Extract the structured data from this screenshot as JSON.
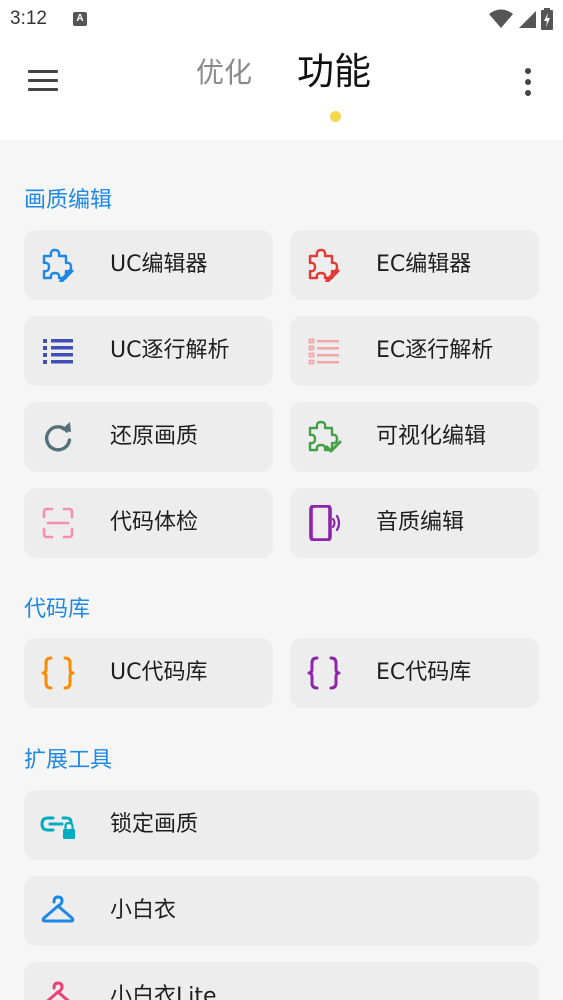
{
  "status_bar": {
    "time": "3:12",
    "notification": "A"
  },
  "header": {
    "tab_optimize": "优化",
    "tab_functions": "功能"
  },
  "sections": {
    "editing": {
      "title": "画质编辑",
      "items": [
        "UC编辑器",
        "EC编辑器",
        "UC逐行解析",
        "EC逐行解析",
        "还原画质",
        "可视化编辑",
        "代码体检",
        "音质编辑"
      ]
    },
    "library": {
      "title": "代码库",
      "items": [
        "UC代码库",
        "EC代码库"
      ]
    },
    "tools": {
      "title": "扩展工具",
      "items": [
        "锁定画质",
        "小白衣",
        "小白衣Lite"
      ]
    }
  },
  "colors": {
    "accent": "#1e88e5",
    "tab_indicator": "#f6d74c",
    "card_background": "#ededee",
    "page_background": "#f6f6f6"
  }
}
